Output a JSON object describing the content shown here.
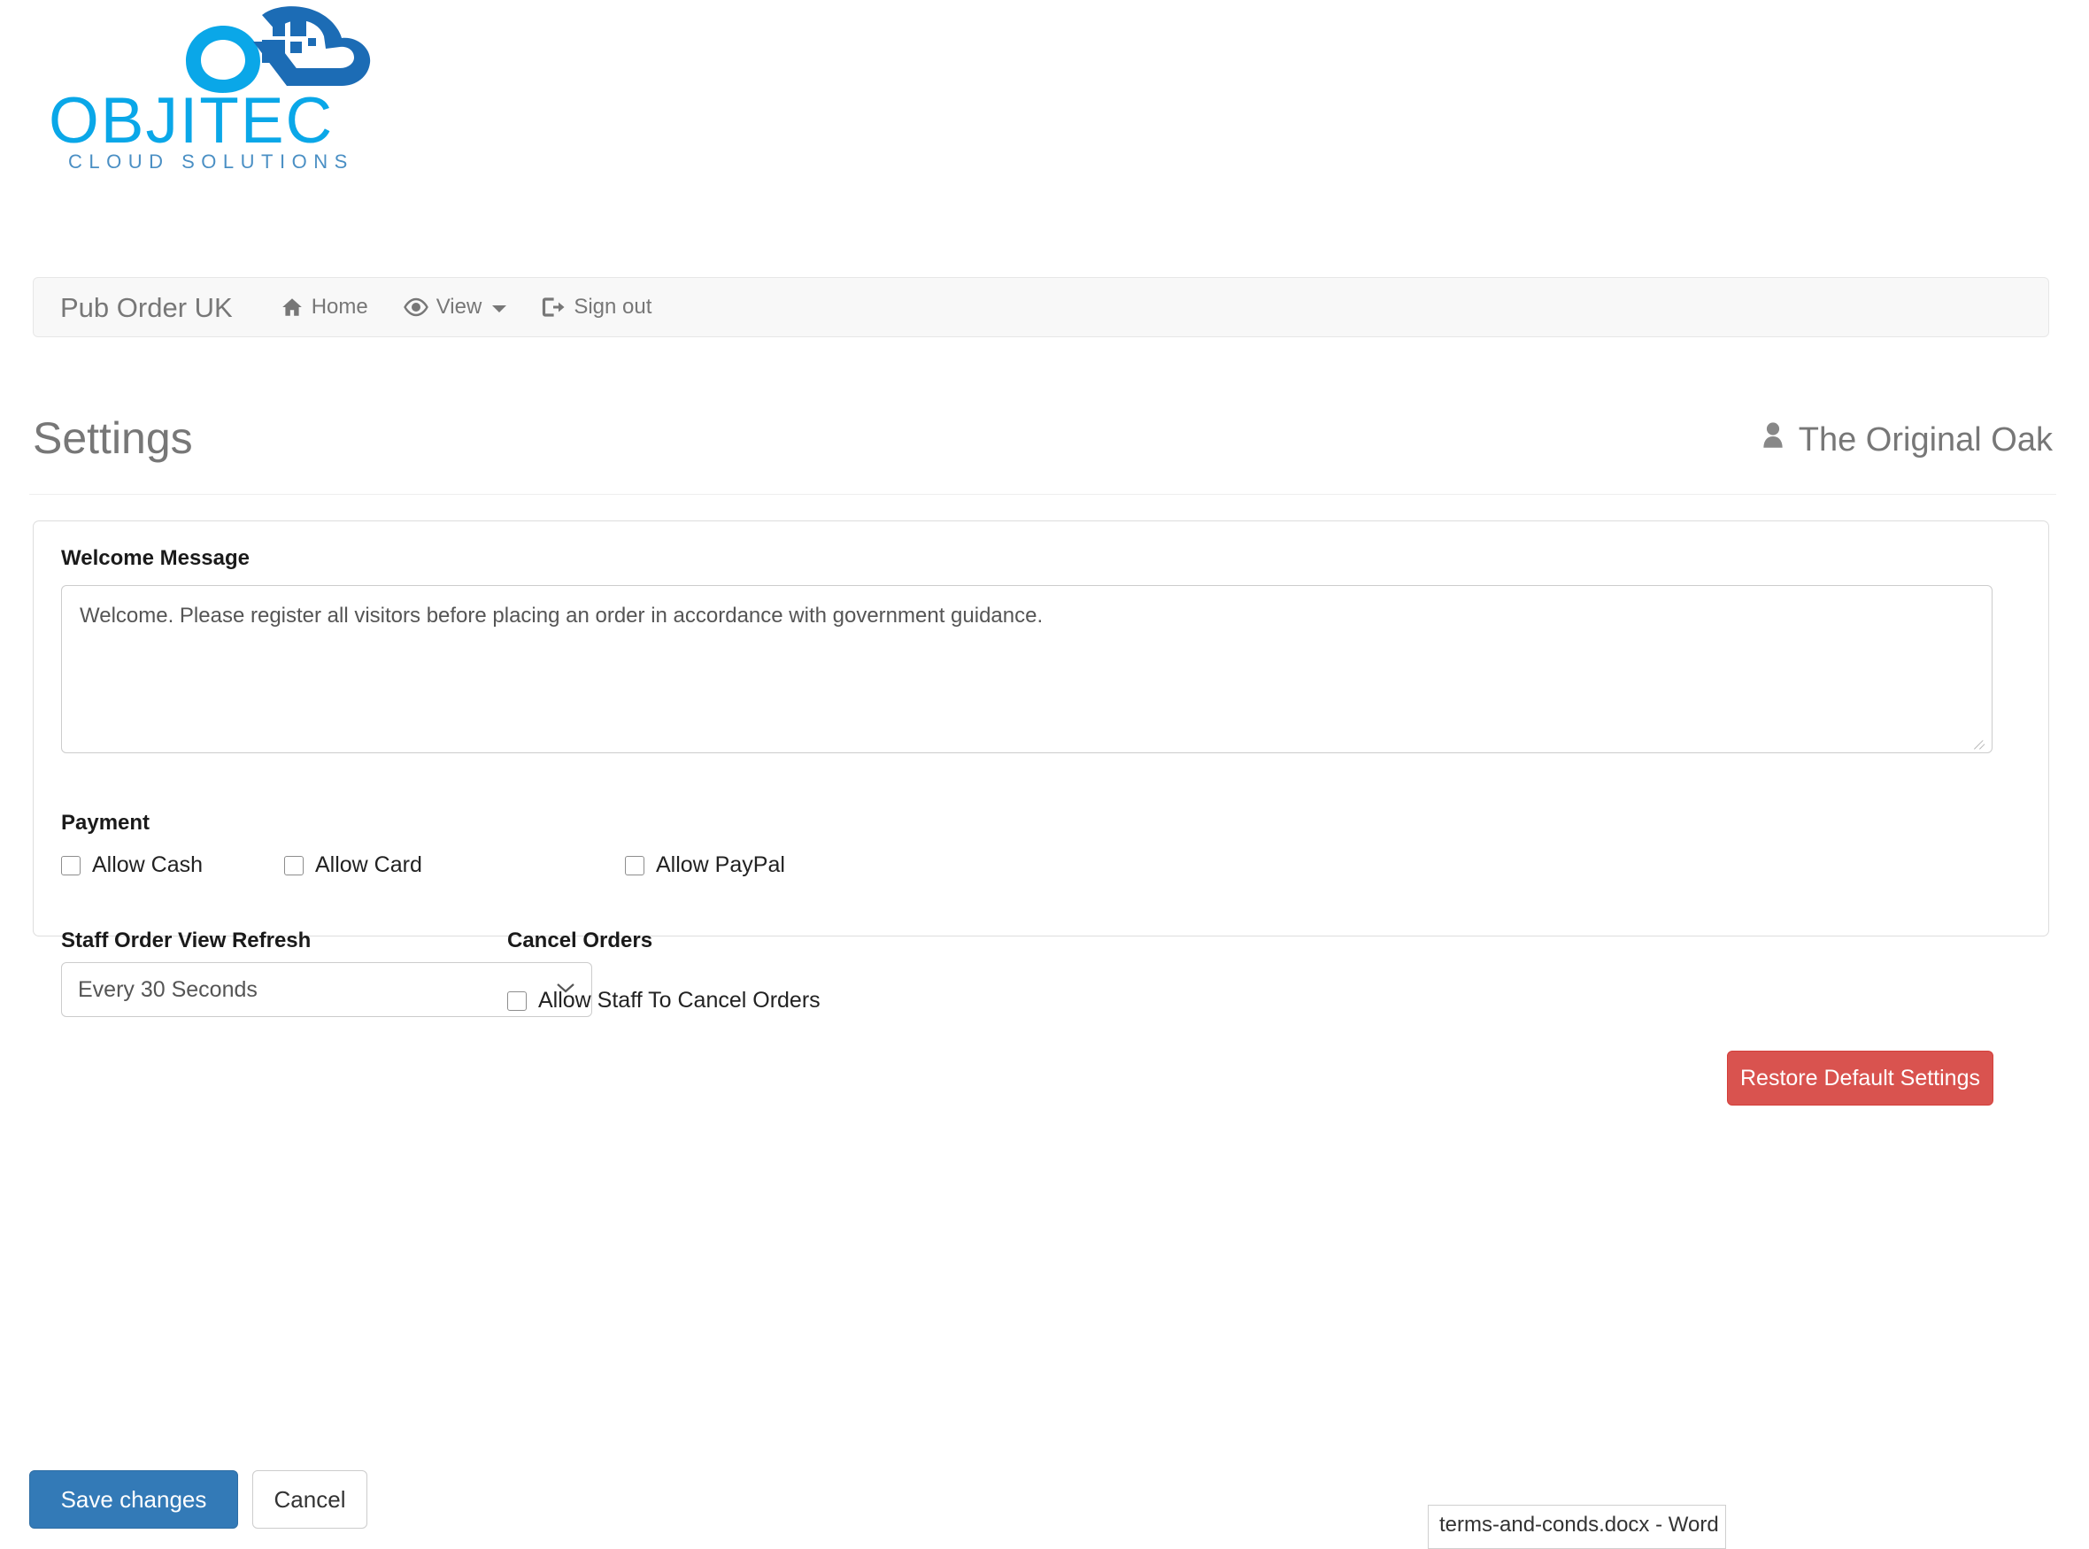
{
  "logo": {
    "wordmark": "OBJITEC",
    "tagline": "CLOUD SOLUTIONS",
    "primary_color": "#0aa7e8",
    "secondary_color": "#1c6cb5",
    "mark_name": "objitec-cloud-logo"
  },
  "navbar": {
    "brand": "Pub Order UK",
    "items": [
      {
        "label": "Home",
        "icon": "home-icon",
        "has_caret": false
      },
      {
        "label": "View",
        "icon": "eye-icon",
        "has_caret": true
      },
      {
        "label": "Sign out",
        "icon": "sign-out-icon",
        "has_caret": false
      }
    ]
  },
  "page": {
    "title": "Settings",
    "user": "The Original Oak",
    "user_icon": "user-icon"
  },
  "form": {
    "welcome": {
      "label": "Welcome Message",
      "value": "Welcome. Please register all visitors before placing an order in accordance with government guidance."
    },
    "payment": {
      "label": "Payment",
      "options": [
        {
          "label": "Allow Cash",
          "checked": false
        },
        {
          "label": "Allow Card",
          "checked": false
        },
        {
          "label": "Allow PayPal",
          "checked": false
        }
      ]
    },
    "refresh": {
      "label": "Staff Order View Refresh",
      "selected": "Every 30 Seconds"
    },
    "cancel_orders": {
      "label": "Cancel Orders",
      "option": {
        "label": "Allow Staff To Cancel Orders",
        "checked": false
      }
    },
    "restore_button": "Restore Default Settings"
  },
  "footer": {
    "save_label": "Save changes",
    "cancel_label": "Cancel"
  },
  "taskbar": {
    "item_label": "terms-and-conds.docx - Word"
  },
  "colors": {
    "primary_button": "#337ab7",
    "danger_button": "#d9534f",
    "navbar_bg": "#f8f8f8",
    "muted_text": "#777777"
  }
}
